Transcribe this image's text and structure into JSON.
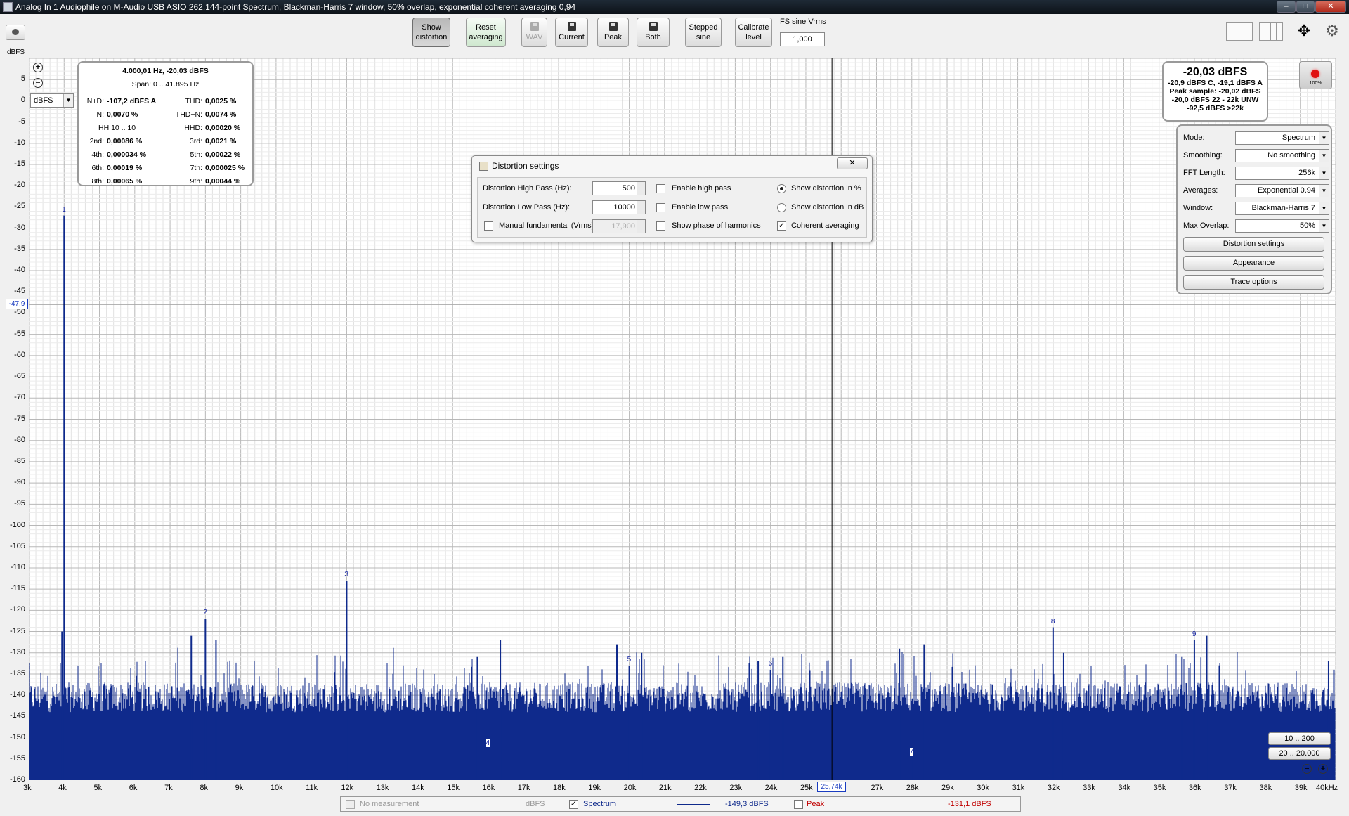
{
  "window": {
    "title": "Analog In 1 Audiophile on M-Audio USB ASIO 262.144-point Spectrum, Blackman-Harris 7 window, 50% overlap, exponential coherent averaging 0,94",
    "minimize": "–",
    "maximize": "□",
    "close": "✕"
  },
  "toolbar": {
    "show_distortion": [
      "Show",
      "distortion"
    ],
    "reset_averaging": [
      "Reset",
      "averaging"
    ],
    "wav": "WAV",
    "current": "Current",
    "peak": "Peak",
    "both": "Both",
    "stepped_sine": [
      "Stepped",
      "sine"
    ],
    "calibrate_level": [
      "Calibrate",
      "level"
    ],
    "fs_sine_label": "FS sine Vrms",
    "fs_sine_value": "1,000"
  },
  "plot": {
    "unit_label": "dBFS",
    "unit_select": "dBFS",
    "y_ticks": [
      "5",
      "0",
      "-5",
      "-10",
      "-15",
      "-20",
      "-25",
      "-30",
      "-35",
      "-40",
      "-45",
      "-50",
      "-55",
      "-60",
      "-65",
      "-70",
      "-75",
      "-80",
      "-85",
      "-90",
      "-95",
      "-100",
      "-105",
      "-110",
      "-115",
      "-120",
      "-125",
      "-130",
      "-135",
      "-140",
      "-145",
      "-150",
      "-155",
      "-160"
    ],
    "x_ticks": [
      "3k",
      "4k",
      "5k",
      "6k",
      "7k",
      "8k",
      "9k",
      "10k",
      "11k",
      "12k",
      "13k",
      "14k",
      "15k",
      "16k",
      "17k",
      "18k",
      "19k",
      "20k",
      "21k",
      "22k",
      "23k",
      "24k",
      "25k",
      "",
      "27k",
      "28k",
      "29k",
      "30k",
      "31k",
      "32k",
      "33k",
      "34k",
      "35k",
      "36k",
      "37k",
      "38k",
      "39k",
      "40kHz"
    ],
    "cursor_x": "25,74k",
    "cursor_y": "-47,9"
  },
  "chart_data": {
    "type": "line",
    "title": "",
    "xlabel": "",
    "ylabel": "dBFS",
    "xlim": [
      3000,
      40000
    ],
    "ylim": [
      -160,
      10
    ],
    "noise_floor_db": -150,
    "series": [
      {
        "name": "Spectrum",
        "color": "#0f2a8c"
      }
    ],
    "harmonics": [
      {
        "label": "1",
        "freq": 4000,
        "db": -27
      },
      {
        "label": "2",
        "freq": 8000,
        "db": -122
      },
      {
        "label": "3",
        "freq": 12000,
        "db": -113
      },
      {
        "label": "4",
        "freq": 16000,
        "db": -150
      },
      {
        "label": "5",
        "freq": 20000,
        "db": -133
      },
      {
        "label": "6",
        "freq": 24000,
        "db": -134
      },
      {
        "label": "7",
        "freq": 28000,
        "db": -152
      },
      {
        "label": "8",
        "freq": 32000,
        "db": -124
      },
      {
        "label": "9",
        "freq": 36000,
        "db": -127
      }
    ],
    "spurs": [
      {
        "freq": 3940,
        "db": -125
      },
      {
        "freq": 7600,
        "db": -126
      },
      {
        "freq": 8300,
        "db": -127
      },
      {
        "freq": 15700,
        "db": -131
      },
      {
        "freq": 16350,
        "db": -127
      },
      {
        "freq": 19650,
        "db": -128
      },
      {
        "freq": 20350,
        "db": -130
      },
      {
        "freq": 23650,
        "db": -132
      },
      {
        "freq": 24350,
        "db": -131
      },
      {
        "freq": 27650,
        "db": -129
      },
      {
        "freq": 28350,
        "db": -128
      },
      {
        "freq": 32300,
        "db": -130
      },
      {
        "freq": 35650,
        "db": -131
      },
      {
        "freq": 36350,
        "db": -126
      },
      {
        "freq": 39800,
        "db": -132
      },
      {
        "freq": 39950,
        "db": -134
      }
    ]
  },
  "readout": {
    "header": "4.000,01 Hz, -20,03 dBFS",
    "span": "Span: 0 .. 41.895 Hz",
    "rows": [
      {
        "lk": "N+D:",
        "lv": "-107,2 dBFS A",
        "rk": "THD:",
        "rv": "0,0025 %"
      },
      {
        "lk": "N:",
        "lv": "0,0070 %",
        "rk": "THD+N:",
        "rv": "0,0074 %"
      },
      {
        "lk": "",
        "lv": "HH 10 .. 10",
        "rk": "HHD:",
        "rv": "0,00020 %"
      },
      {
        "lk": "2nd:",
        "lv": "0,00086 %",
        "rk": "3rd:",
        "rv": "0,0021 %"
      },
      {
        "lk": "4th:",
        "lv": "0,000034 %",
        "rk": "5th:",
        "rv": "0,00022 %"
      },
      {
        "lk": "6th:",
        "lv": "0,00019 %",
        "rk": "7th:",
        "rv": "0,000025 %"
      },
      {
        "lk": "8th:",
        "lv": "0,00065 %",
        "rk": "9th:",
        "rv": "0,00044 %"
      }
    ]
  },
  "dialog": {
    "title": "Distortion settings",
    "close": "✕",
    "high_pass_label": "Distortion High Pass (Hz):",
    "high_pass_value": "500",
    "low_pass_label": "Distortion Low Pass (Hz):",
    "low_pass_value": "10000",
    "manual_fundamental_label": "Manual fundamental (Vrms)",
    "manual_fundamental_value": "17,900",
    "enable_high_pass": "Enable high pass",
    "enable_low_pass": "Enable low pass",
    "show_phase": "Show phase of harmonics",
    "show_percent": "Show distortion in %",
    "show_db": "Show distortion in dB",
    "coherent_averaging": "Coherent averaging"
  },
  "level": {
    "main": "-20,03 dBFS",
    "line1": "-20,9 dBFS C, -19,1 dBFS A",
    "line2": "Peak sample: -20,02 dBFS",
    "line3": "-20,0 dBFS 22 - 22k UNW",
    "line4": "-92,5 dBFS >22k",
    "record_pct": "100%"
  },
  "controls": {
    "mode_label": "Mode:",
    "mode": "Spectrum",
    "smoothing_label": "Smoothing:",
    "smoothing": "No  smoothing",
    "fft_label": "FFT Length:",
    "fft": "256k",
    "averages_label": "Averages:",
    "averages": "Exponential 0.94",
    "window_label": "Window:",
    "window": "Blackman-Harris 7",
    "overlap_label": "Max Overlap:",
    "overlap": "50%",
    "distortion_settings": "Distortion settings",
    "appearance": "Appearance",
    "trace_options": "Trace options"
  },
  "range_buttons": {
    "r1": "10 .. 200",
    "r2": "20 .. 20.000"
  },
  "legend": {
    "no_measurement": "No measurement",
    "no_measurement_unit": "dBFS",
    "spectrum": "Spectrum",
    "spectrum_value": "-149,3 dBFS",
    "peak": "Peak",
    "peak_value": "-131,1 dBFS",
    "spectrum_color": "#0f2a8c",
    "peak_color": "#c00000"
  }
}
